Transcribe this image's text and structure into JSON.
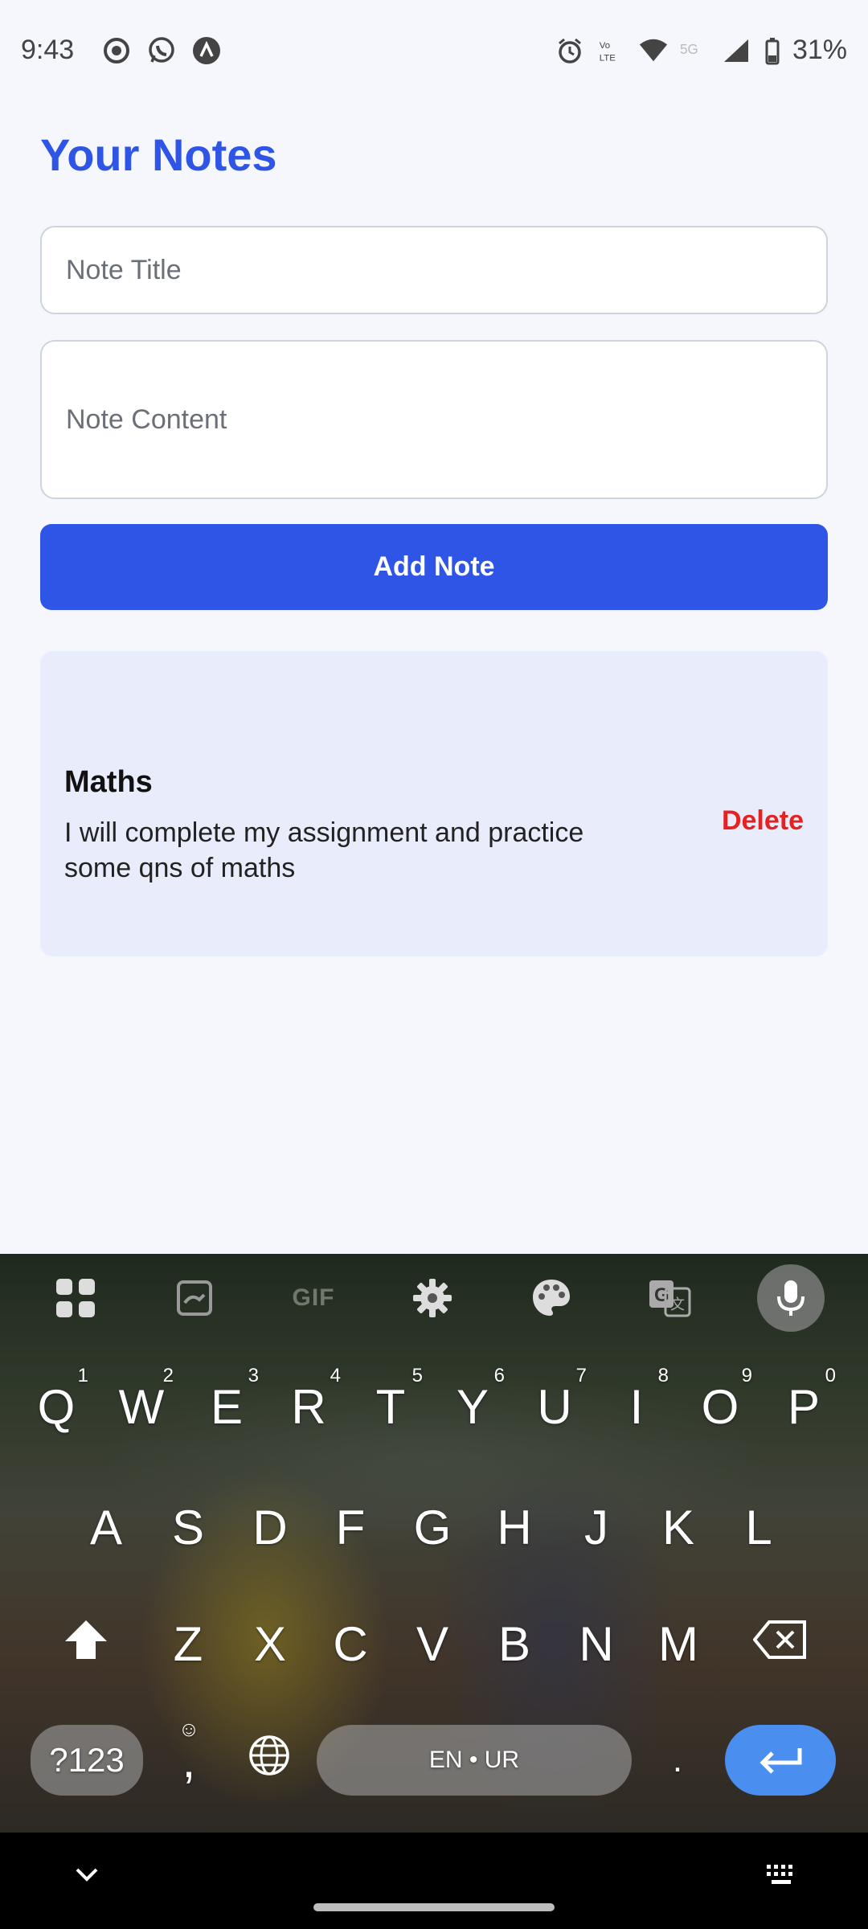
{
  "status_bar": {
    "time": "9:43",
    "battery": "31%",
    "left_icons": [
      "screen-record-icon",
      "whatsapp-icon",
      "app-notification-icon"
    ],
    "right_icons": [
      "alarm-icon",
      "volte-icon",
      "wifi-icon",
      "5g-icon",
      "signal-icon",
      "battery-icon"
    ]
  },
  "app": {
    "title": "Your Notes",
    "title_color": "#2f55e6",
    "note_title_placeholder": "Note Title",
    "note_content_placeholder": "Note Content",
    "add_button_label": "Add Note",
    "notes": [
      {
        "title": "Maths",
        "content": "I will complete my assignment and practice some qns of maths",
        "delete_label": "Delete"
      }
    ]
  },
  "keyboard": {
    "toolbar": [
      "apps-grid-icon",
      "sticker-icon",
      "GIF",
      "settings-icon",
      "palette-icon",
      "translate-icon",
      "mic-icon"
    ],
    "row1": [
      "Q",
      "W",
      "E",
      "R",
      "T",
      "Y",
      "U",
      "I",
      "O",
      "P"
    ],
    "row1_hints": [
      "1",
      "2",
      "3",
      "4",
      "5",
      "6",
      "7",
      "8",
      "9",
      "0"
    ],
    "row2": [
      "A",
      "S",
      "D",
      "F",
      "G",
      "H",
      "J",
      "K",
      "L"
    ],
    "row3": [
      "Z",
      "X",
      "C",
      "V",
      "B",
      "N",
      "M"
    ],
    "symbols_label": "?123",
    "comma": ",",
    "space_label": "EN • UR",
    "period": ".",
    "enter_color": "#4a8ef0"
  }
}
